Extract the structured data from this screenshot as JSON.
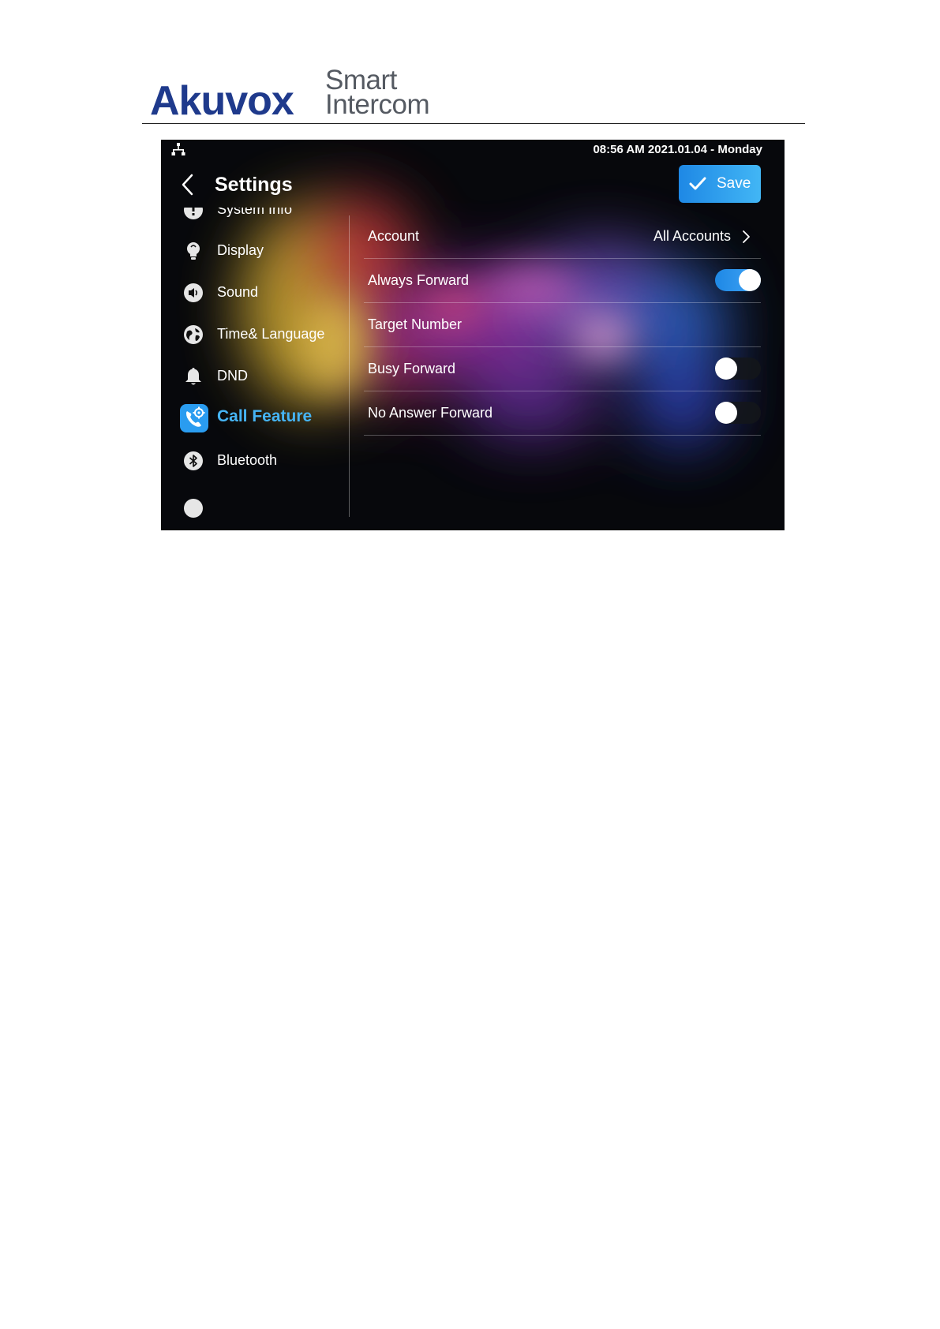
{
  "document": {
    "logo_brand": "Akuvox",
    "logo_tagline_1": "Smart",
    "logo_tagline_2": "Intercom"
  },
  "status_bar": {
    "datetime": "08:56 AM  2021.01.04 - Monday",
    "network_icon": "network-icon"
  },
  "header": {
    "title": "Settings",
    "save_label": "Save",
    "back_icon": "chevron-left-icon",
    "save_icon": "check-icon"
  },
  "sidebar": {
    "items": [
      {
        "label": "System Info",
        "icon": "info-icon",
        "active": false
      },
      {
        "label": "Display",
        "icon": "lightbulb-icon",
        "active": false
      },
      {
        "label": "Sound",
        "icon": "speaker-icon",
        "active": false
      },
      {
        "label": "Time& Language",
        "icon": "globe-icon",
        "active": false
      },
      {
        "label": "DND",
        "icon": "bell-icon",
        "active": false
      },
      {
        "label": "Call Feature",
        "icon": "phone-gear-icon",
        "active": true
      },
      {
        "label": "Bluetooth",
        "icon": "bluetooth-icon",
        "active": false
      }
    ]
  },
  "settings": {
    "account": {
      "label": "Account",
      "value": "All Accounts"
    },
    "always_forward": {
      "label": "Always Forward",
      "enabled": true
    },
    "target_number": {
      "label": "Target Number"
    },
    "busy_forward": {
      "label": "Busy Forward",
      "enabled": false
    },
    "no_answer_forward": {
      "label": "No Answer Forward",
      "enabled": false
    }
  },
  "colors": {
    "accent": "#46b4f4",
    "save_button": "#1e88e5",
    "logo_brand": "#1f3a8c",
    "background": "#07080c"
  }
}
